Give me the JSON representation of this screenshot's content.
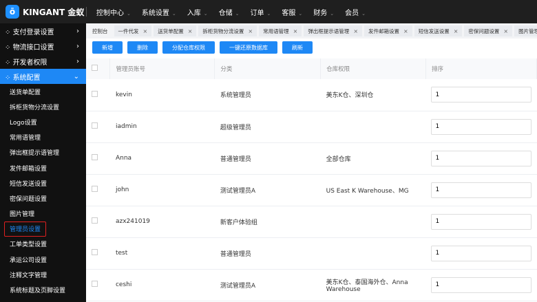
{
  "brand": {
    "name": "KINGANT 金蚁"
  },
  "topnav": [
    "控制中心",
    "系统设置",
    "入库",
    "仓储",
    "订单",
    "客服",
    "财务",
    "会员"
  ],
  "sidebar": {
    "groups": [
      "支付登录设置",
      "物流接口设置",
      "开发者权限",
      "系统配置"
    ],
    "items": [
      "送货单配置",
      "拆柜货物分流设置",
      "Logo设置",
      "常用语管理",
      "弹出框提示语管理",
      "发件邮箱设置",
      "短信发送设置",
      "密保问题设置",
      "图片管理",
      "管理员设置",
      "工单类型设置",
      "承运公司设置",
      "注释文字管理",
      "系统标题及页脚设置"
    ],
    "selected": "管理员设置"
  },
  "tabs": [
    "控制台",
    "一件代发",
    "送货单配置",
    "拆柜货物分流设置",
    "常用语管理",
    "弹出框提示语管理",
    "发件邮箱设置",
    "短信发送设置",
    "密保问题设置",
    "图片管理"
  ],
  "toolbar": [
    "新增",
    "删除",
    "分配仓库权限",
    "一键还原数据库",
    "刷新"
  ],
  "table": {
    "headers": [
      "管理员账号",
      "分类",
      "仓库权限",
      "排序"
    ],
    "rows": [
      {
        "account": "kevin",
        "category": "系统管理员",
        "warehouse": "美东K仓、深圳仓",
        "sort": "1"
      },
      {
        "account": "iadmin",
        "category": "超级管理员",
        "warehouse": "",
        "sort": "1"
      },
      {
        "account": "Anna",
        "category": "普通管理员",
        "warehouse": "全部仓库",
        "sort": "1"
      },
      {
        "account": "john",
        "category": "测试管理员A",
        "warehouse": "US East K Warehouse、MG",
        "sort": "1"
      },
      {
        "account": "azx241019",
        "category": "新客户体验组",
        "warehouse": "",
        "sort": "1"
      },
      {
        "account": "test",
        "category": "普通管理员",
        "warehouse": "",
        "sort": "1"
      },
      {
        "account": "ceshi",
        "category": "测试管理员A",
        "warehouse": "美东K仓、泰国海外仓、Anna Warehouse",
        "sort": "1"
      }
    ]
  },
  "colors": {
    "accent": "#1e88f5",
    "topbar": "#1f1f1f",
    "sidebar": "#111111",
    "highlight": "#e02020"
  }
}
